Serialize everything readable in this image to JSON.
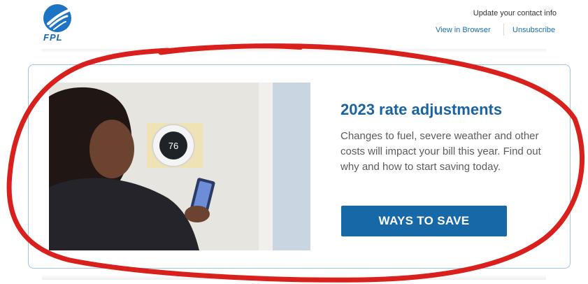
{
  "brand": {
    "logo_text": "FPL",
    "color": "#1667ad"
  },
  "header": {
    "update_contact": "Update your contact info",
    "view_in_browser": "View in Browser",
    "unsubscribe": "Unsubscribe"
  },
  "promo": {
    "title": "2023 rate adjustments",
    "description": "Changes to fuel, severe weather and other costs will impact your bill this year. Find out why and how to start saving today.",
    "cta_label": "WAYS TO SAVE",
    "image_subject": "woman-using-smartphone-with-smart-thermostat",
    "thermostat_reading": "76"
  },
  "colors": {
    "accent": "#1a63a3",
    "button": "#1668a7",
    "annotation": "#d9201c",
    "card_border": "#9cc6e3"
  }
}
